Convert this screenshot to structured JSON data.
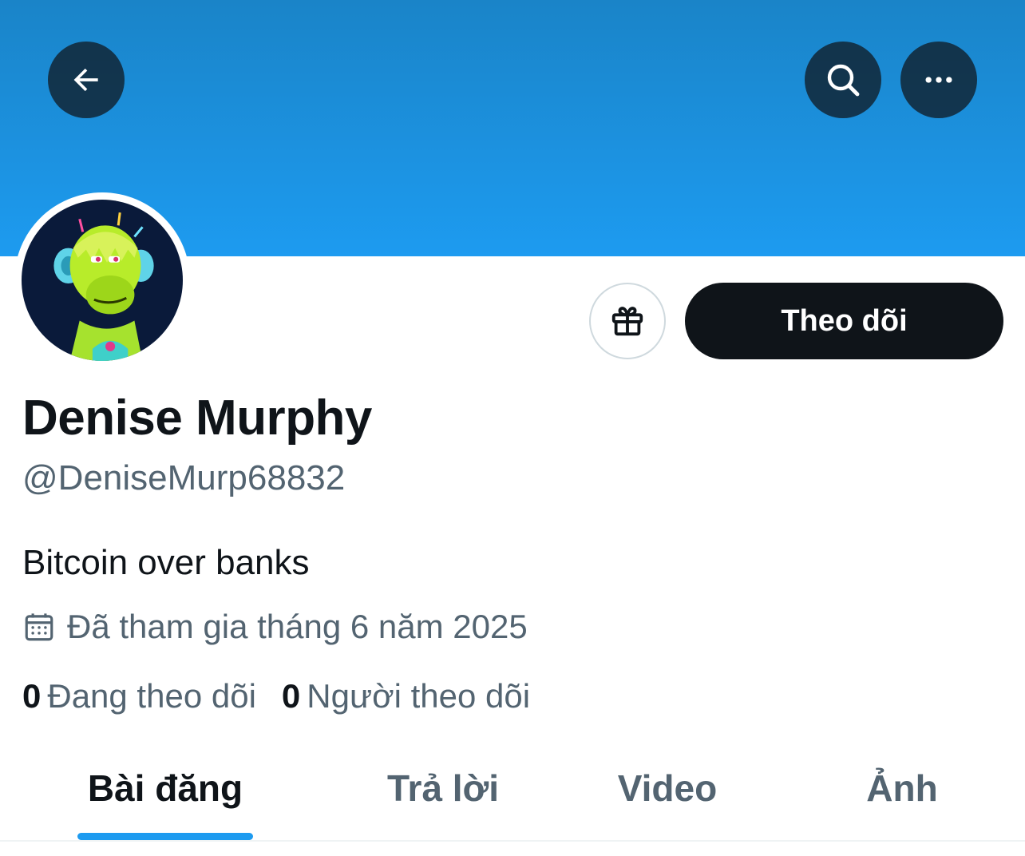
{
  "header": {
    "banner_color": "#1d9bf0",
    "back_icon": "arrow-left-icon",
    "search_icon": "search-icon",
    "more_icon": "more-horizontal-icon"
  },
  "profile": {
    "avatar_icon": "avatar-ape-icon",
    "display_name": "Denise Murphy",
    "handle": "@DeniseMurp68832",
    "bio": "Bitcoin over banks",
    "joined": "Đã tham gia tháng 6 năm 2025",
    "joined_icon": "calendar-icon"
  },
  "actions": {
    "gift_icon": "gift-icon",
    "follow_label": "Theo dõi"
  },
  "stats": {
    "following_count": "0",
    "following_label": "Đang theo dõi",
    "followers_count": "0",
    "followers_label": "Người theo dõi"
  },
  "tabs": [
    {
      "label": "Bài đăng",
      "active": true
    },
    {
      "label": "Trả lời",
      "active": false
    },
    {
      "label": "Video",
      "active": false
    },
    {
      "label": "Ảnh",
      "active": false
    }
  ],
  "colors": {
    "accent": "#1d9bf0",
    "text_primary": "#0f1419",
    "text_secondary": "#536471"
  }
}
